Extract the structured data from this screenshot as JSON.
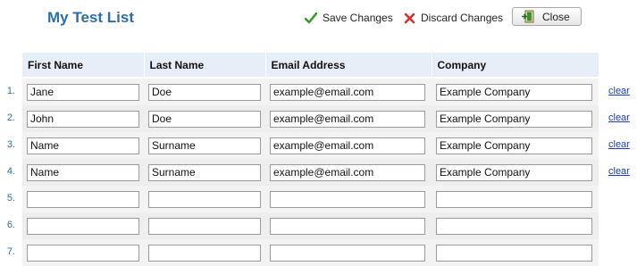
{
  "title": "My Test List",
  "toolbar": {
    "save_label": "Save Changes",
    "save_icon": "checkmark-icon",
    "save_icon_color": "#3a9a2c",
    "discard_label": "Discard Changes",
    "discard_icon": "x-icon",
    "discard_icon_color": "#d92e2e",
    "close_label": "Close",
    "close_icon": "exit-door-icon"
  },
  "columns": [
    "First Name",
    "Last Name",
    "Email Address",
    "Company"
  ],
  "rows": [
    {
      "num": "1.",
      "first": "Jane",
      "last": "Doe",
      "email": "example@email.com",
      "company": "Example Company",
      "action": "clear"
    },
    {
      "num": "2.",
      "first": "John",
      "last": "Doe",
      "email": "example@email.com",
      "company": "Example Company",
      "action": "clear"
    },
    {
      "num": "3.",
      "first": "Name",
      "last": "Surname",
      "email": "example@email.com",
      "company": "Example Company",
      "action": "clear"
    },
    {
      "num": "4.",
      "first": "Name",
      "last": "Surname",
      "email": "example@email.com",
      "company": "Example Company",
      "action": "clear"
    },
    {
      "num": "5.",
      "first": "",
      "last": "",
      "email": "",
      "company": "",
      "action": ""
    },
    {
      "num": "6.",
      "first": "",
      "last": "",
      "email": "",
      "company": "",
      "action": ""
    },
    {
      "num": "7.",
      "first": "",
      "last": "",
      "email": "",
      "company": "",
      "action": ""
    }
  ],
  "colors": {
    "accent": "#2c6ea8",
    "header_bg": "#e6eef8",
    "link": "#1a3db8"
  }
}
